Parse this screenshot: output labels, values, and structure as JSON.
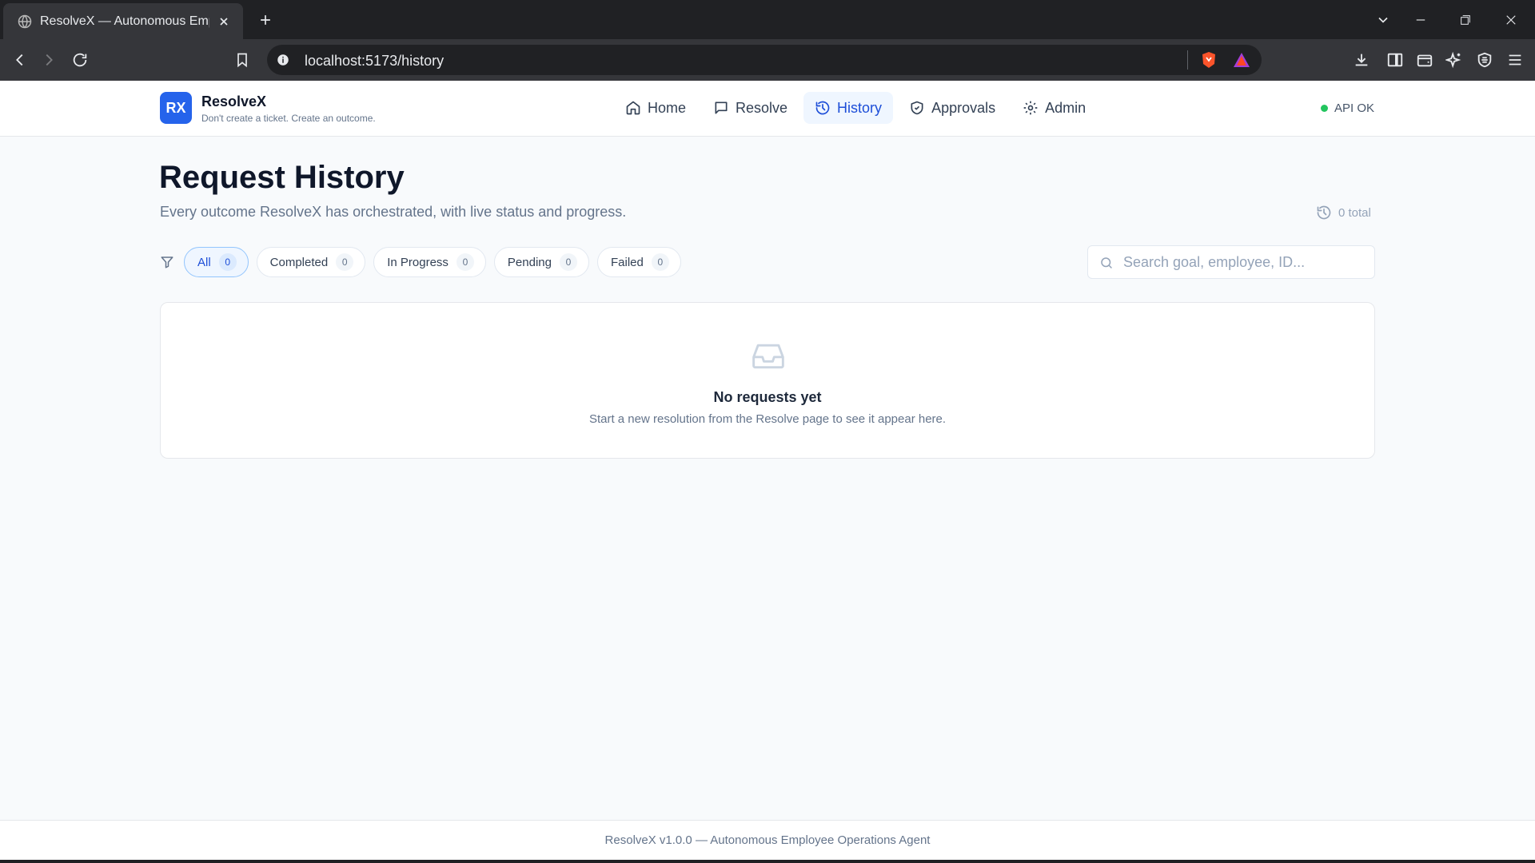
{
  "browser": {
    "tab_title": "ResolveX — Autonomous Emplo",
    "url": "localhost:5173/history"
  },
  "app": {
    "logo_text": "RX",
    "name": "ResolveX",
    "tagline": "Don't create a ticket. Create an outcome.",
    "nav": [
      {
        "label": "Home",
        "icon": "home-icon"
      },
      {
        "label": "Resolve",
        "icon": "message-icon"
      },
      {
        "label": "History",
        "icon": "history-icon",
        "active": true
      },
      {
        "label": "Approvals",
        "icon": "shield-check-icon"
      },
      {
        "label": "Admin",
        "icon": "gear-icon"
      }
    ],
    "api_status": "API OK",
    "api_status_color": "#22c55e",
    "accent_color": "#2563eb"
  },
  "page": {
    "title": "Request History",
    "subtitle": "Every outcome ResolveX has orchestrated, with live status and progress.",
    "total": "0 total"
  },
  "filters": [
    {
      "label": "All",
      "count": "0",
      "active": true
    },
    {
      "label": "Completed",
      "count": "0"
    },
    {
      "label": "In Progress",
      "count": "0"
    },
    {
      "label": "Pending",
      "count": "0"
    },
    {
      "label": "Failed",
      "count": "0"
    }
  ],
  "search": {
    "placeholder": "Search goal, employee, ID...",
    "value": ""
  },
  "empty_state": {
    "icon": "inbox-icon",
    "title": "No requests yet",
    "description": "Start a new resolution from the Resolve page to see it appear here."
  },
  "footer": {
    "text": "ResolveX v1.0.0 — Autonomous Employee Operations Agent"
  }
}
